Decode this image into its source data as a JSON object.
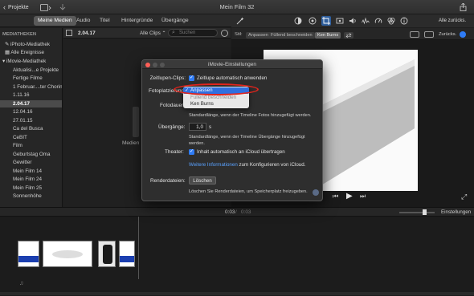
{
  "window": {
    "title": "Mein Film 32"
  },
  "titlebar": {
    "back_label": "Projekte"
  },
  "tabs": [
    {
      "label": "Meine Medien",
      "active": true
    },
    {
      "label": "Audio",
      "active": false
    },
    {
      "label": "Titel",
      "active": false
    },
    {
      "label": "Hintergründe",
      "active": false
    },
    {
      "label": "Übergänge",
      "active": false
    }
  ],
  "viewer_toolbar": {
    "reset_all": "Alle zurücks."
  },
  "viewer_crop": {
    "label": "Stil:",
    "options": [
      "Anpassen",
      "Füllend beschneiden",
      "Ken Burns"
    ],
    "active": "Ken Burns",
    "reset": "Zurücks."
  },
  "sidebar": {
    "header": "MEDIATHEKEN",
    "items": [
      {
        "label": "iPhoto-Mediathek",
        "indent": 1
      },
      {
        "label": "Alle Ereignisse",
        "indent": 1
      },
      {
        "label": "iMovie-Mediathek",
        "indent": 0
      },
      {
        "label": "Aktualisi...e Projekte",
        "indent": 2
      },
      {
        "label": "Fertige Filme",
        "indent": 2
      },
      {
        "label": "1 Februar....ter Chorin",
        "indent": 2
      },
      {
        "label": "1.11.16",
        "indent": 2
      },
      {
        "label": "2.04.17",
        "indent": 2,
        "selected": true
      },
      {
        "label": "12.04.16",
        "indent": 2
      },
      {
        "label": "27.01.15",
        "indent": 2
      },
      {
        "label": "Ca del Busca",
        "indent": 2
      },
      {
        "label": "CeBIT",
        "indent": 2
      },
      {
        "label": "Film",
        "indent": 2
      },
      {
        "label": "Geburtstag Oma",
        "indent": 2
      },
      {
        "label": "Gewitter",
        "indent": 2
      },
      {
        "label": "Mein Film 14",
        "indent": 2
      },
      {
        "label": "Mein Film 24",
        "indent": 2
      },
      {
        "label": "Mein Film 25",
        "indent": 2
      },
      {
        "label": "Sonnenhöhe",
        "indent": 2
      }
    ]
  },
  "browser": {
    "event_title": "2.04.17",
    "filter": "Alle Clips",
    "search_placeholder": "Suchen",
    "media_caption": "Medien"
  },
  "timeline": {
    "timecode": "0:03",
    "duration": "0:03",
    "settings": "Einstellungen"
  },
  "dialog": {
    "title": "iMovie-Einstellungen",
    "clips_label": "Zeitlupen-Clips:",
    "clips_option": "Zeitlupe automatisch anwenden",
    "photo_label": "Fotoplatzierung",
    "photo_options": [
      "Anpassen",
      "Füllend beschneiden",
      "Ken Burns"
    ],
    "photo_selected": "Anpassen",
    "photo_duration_label": "Fotodauer",
    "photo_duration_note": "Standardlänge, wenn der Timeline Fotos hinzugefügt werden.",
    "transitions_label": "Übergänge:",
    "transitions_value": "1,0",
    "transitions_unit": "s",
    "transitions_note": "Standardlänge, wenn der Timeline Übergänge hinzugefügt werden.",
    "theater_label": "Theater:",
    "theater_option": "Inhalt automatisch an iCloud übertragen",
    "more_info_link": "Weitere Informationen",
    "more_info_rest": "zum Konfigurieren von iCloud.",
    "render_label": "Renderdateien:",
    "render_button": "Löschen",
    "render_note": "Löschen Sie Renderdateien, um Speicherplatz freizugeben."
  },
  "colors": {
    "accent": "#2f7cf6",
    "highlight_ring": "#e2241c",
    "selection": "#2f6fe0"
  }
}
